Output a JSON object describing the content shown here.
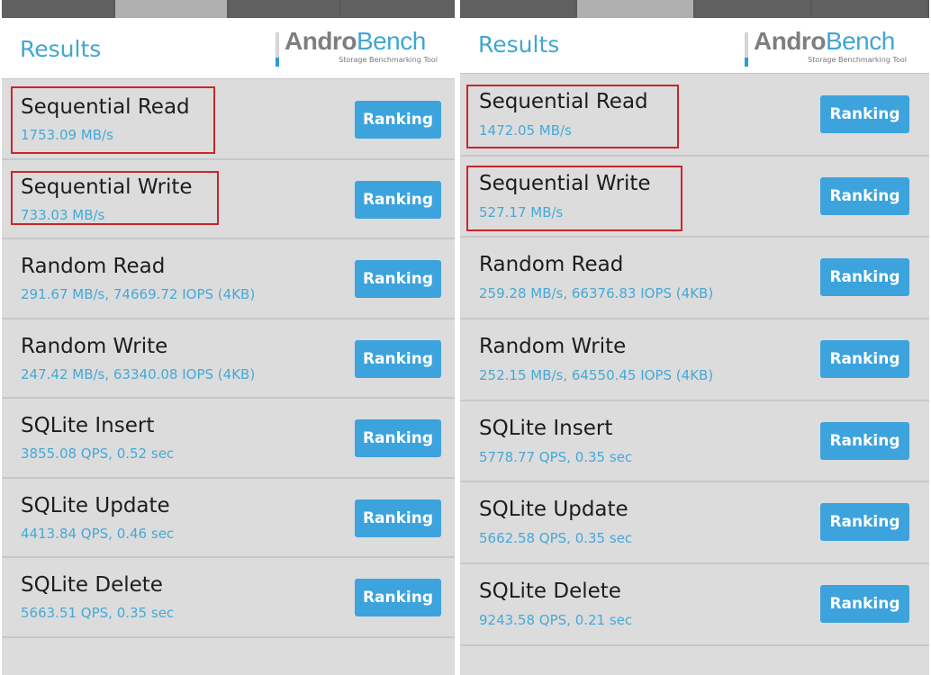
{
  "colors": {
    "accent": "#41a6d3",
    "button": "#3ca3dd",
    "highlight": "#c9262c",
    "row_background": "#dcdcdc"
  },
  "panels": [
    {
      "title": "Results",
      "logo": {
        "name_part1": "Andro",
        "name_part2": "Bench",
        "tagline": "Storage Benchmarking Tool"
      },
      "results": [
        {
          "name": "Sequential Read",
          "value": "1753.09 MB/s",
          "button": "Ranking",
          "highlighted": true
        },
        {
          "name": "Sequential Write",
          "value": "733.03 MB/s",
          "button": "Ranking",
          "highlighted": true
        },
        {
          "name": "Random Read",
          "value": "291.67 MB/s, 74669.72 IOPS (4KB)",
          "button": "Ranking",
          "highlighted": false
        },
        {
          "name": "Random Write",
          "value": "247.42 MB/s, 63340.08 IOPS (4KB)",
          "button": "Ranking",
          "highlighted": false
        },
        {
          "name": "SQLite Insert",
          "value": "3855.08 QPS, 0.52 sec",
          "button": "Ranking",
          "highlighted": false
        },
        {
          "name": "SQLite Update",
          "value": "4413.84 QPS, 0.46 sec",
          "button": "Ranking",
          "highlighted": false
        },
        {
          "name": "SQLite Delete",
          "value": "5663.51 QPS, 0.35 sec",
          "button": "Ranking",
          "highlighted": false
        }
      ]
    },
    {
      "title": "Results",
      "logo": {
        "name_part1": "Andro",
        "name_part2": "Bench",
        "tagline": "Storage Benchmarking Tool"
      },
      "results": [
        {
          "name": "Sequential Read",
          "value": "1472.05 MB/s",
          "button": "Ranking",
          "highlighted": true
        },
        {
          "name": "Sequential Write",
          "value": "527.17 MB/s",
          "button": "Ranking",
          "highlighted": true
        },
        {
          "name": "Random Read",
          "value": "259.28 MB/s, 66376.83 IOPS (4KB)",
          "button": "Ranking",
          "highlighted": false
        },
        {
          "name": "Random Write",
          "value": "252.15 MB/s, 64550.45 IOPS (4KB)",
          "button": "Ranking",
          "highlighted": false
        },
        {
          "name": "SQLite Insert",
          "value": "5778.77 QPS, 0.35 sec",
          "button": "Ranking",
          "highlighted": false
        },
        {
          "name": "SQLite Update",
          "value": "5662.58 QPS, 0.35 sec",
          "button": "Ranking",
          "highlighted": false
        },
        {
          "name": "SQLite Delete",
          "value": "9243.58 QPS, 0.21 sec",
          "button": "Ranking",
          "highlighted": false
        }
      ]
    }
  ]
}
